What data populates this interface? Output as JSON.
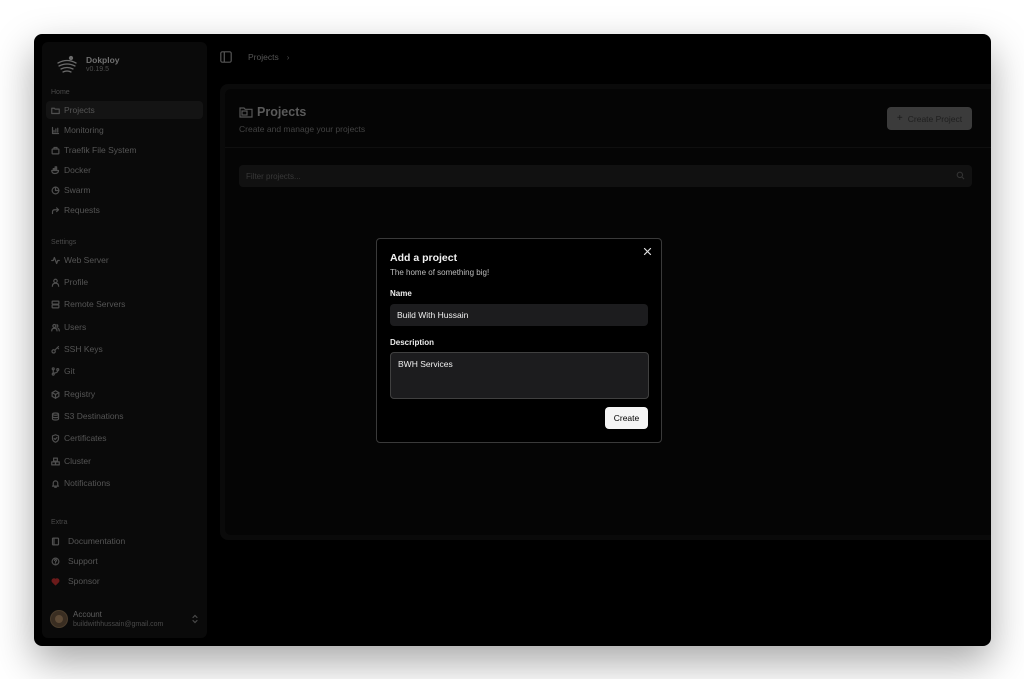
{
  "app": {
    "name": "Dokploy",
    "version": "v0.19.5"
  },
  "sidebar": {
    "home_label": "Home",
    "home_items": [
      {
        "label": "Projects",
        "icon": "folder-icon"
      },
      {
        "label": "Monitoring",
        "icon": "bar-chart-icon"
      },
      {
        "label": "Traefik File System",
        "icon": "file-system-icon"
      },
      {
        "label": "Docker",
        "icon": "docker-icon"
      },
      {
        "label": "Swarm",
        "icon": "pie-chart-icon"
      },
      {
        "label": "Requests",
        "icon": "forward-arrow-icon"
      }
    ],
    "settings_label": "Settings",
    "settings_items": [
      {
        "label": "Web Server",
        "icon": "activity-icon"
      },
      {
        "label": "Profile",
        "icon": "user-icon"
      },
      {
        "label": "Remote Servers",
        "icon": "server-icon"
      },
      {
        "label": "Users",
        "icon": "users-icon"
      },
      {
        "label": "SSH Keys",
        "icon": "key-icon"
      },
      {
        "label": "Git",
        "icon": "git-branch-icon"
      },
      {
        "label": "Registry",
        "icon": "package-icon"
      },
      {
        "label": "S3 Destinations",
        "icon": "database-icon"
      },
      {
        "label": "Certificates",
        "icon": "shield-check-icon"
      },
      {
        "label": "Cluster",
        "icon": "boxes-icon"
      },
      {
        "label": "Notifications",
        "icon": "bell-icon"
      }
    ],
    "extra_label": "Extra",
    "extra_items": [
      {
        "label": "Documentation",
        "icon": "book-icon"
      },
      {
        "label": "Support",
        "icon": "help-circle-icon"
      },
      {
        "label": "Sponsor",
        "icon": "heart-icon"
      }
    ],
    "account": {
      "name": "Account",
      "email": "buildwithhussain@gmail.com"
    }
  },
  "breadcrumb": {
    "item": "Projects",
    "separator": "›"
  },
  "projects": {
    "title": "Projects",
    "subtitle": "Create and manage your projects",
    "create_button": "Create Project",
    "filter_placeholder": "Filter projects..."
  },
  "modal": {
    "title": "Add a project",
    "description": "The home of something big!",
    "name_label": "Name",
    "name_value": "Build With Hussain",
    "description_label": "Description",
    "description_value": "BWH Services",
    "submit_label": "Create",
    "close_icon": "close-icon"
  },
  "colors": {
    "sponsor_heart": "#b91c1c",
    "modal_border": "#3a3a3a",
    "primary_button": "#f5f5f5"
  }
}
